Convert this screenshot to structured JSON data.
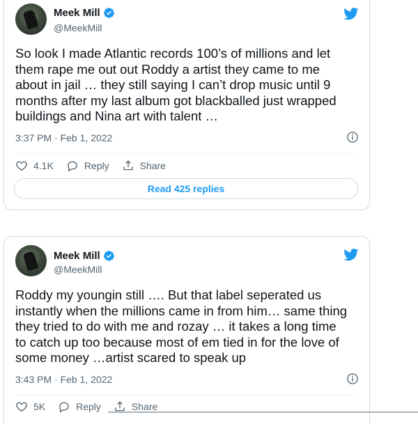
{
  "tweets": [
    {
      "name": "Meek Mill",
      "handle": "@MeekMill",
      "text": "So look I made Atlantic records 100’s of millions and let\nthem rape me out out Roddy a artist they came to me\nabout in jail … they still saying I can’t drop music until 9\nmonths after my last album got blackballed  just wrapped\nbuildings and Nina art with talent …",
      "time": "3:37 PM · Feb 1, 2022",
      "likes": "4.1K",
      "reply_label": "Reply",
      "share_label": "Share",
      "read_replies": "Read 425 replies"
    },
    {
      "name": "Meek Mill",
      "handle": "@MeekMill",
      "text": "Roddy my youngin still …. But that label seperated us\ninstantly when the millions came in from him… same thing\nthey tried to do with me and rozay … it takes a long time\nto catch up too because most of em tied in for the love of\nsome money …artist scared to speak up",
      "time": "3:43 PM · Feb 1, 2022",
      "likes": "5K",
      "reply_label": "Reply",
      "share_label": "Share"
    }
  ],
  "icons": {
    "brand": "twitter-bird-icon",
    "verified": "verified-badge-icon",
    "like": "heart-icon",
    "reply": "reply-bubble-icon",
    "share": "share-icon",
    "info": "info-icon"
  },
  "colors": {
    "accent": "#1d9bf0",
    "text": "#0f1419",
    "muted": "#536471",
    "border": "#cfd9de"
  }
}
